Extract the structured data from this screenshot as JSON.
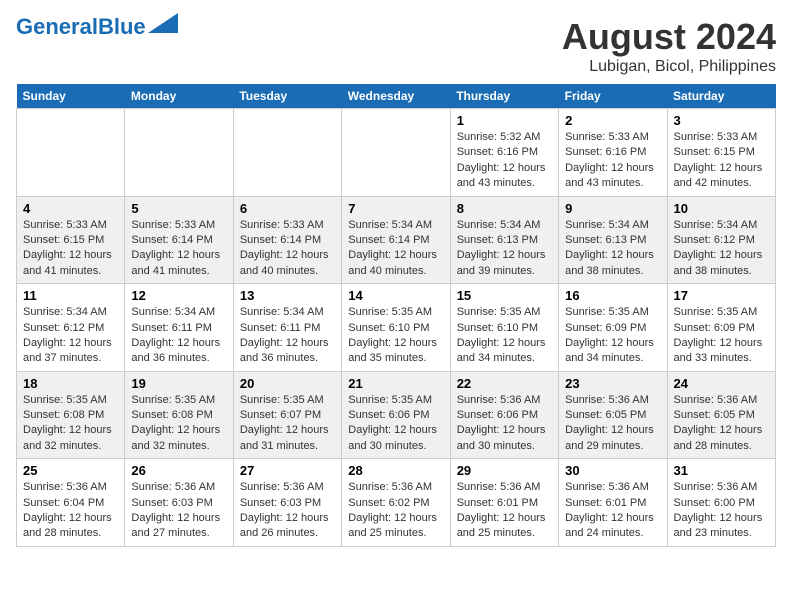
{
  "header": {
    "logo_general": "General",
    "logo_blue": "Blue",
    "title": "August 2024",
    "subtitle": "Lubigan, Bicol, Philippines"
  },
  "days_of_week": [
    "Sunday",
    "Monday",
    "Tuesday",
    "Wednesday",
    "Thursday",
    "Friday",
    "Saturday"
  ],
  "weeks": [
    [
      {
        "day": "",
        "text": ""
      },
      {
        "day": "",
        "text": ""
      },
      {
        "day": "",
        "text": ""
      },
      {
        "day": "",
        "text": ""
      },
      {
        "day": "1",
        "text": "Sunrise: 5:32 AM\nSunset: 6:16 PM\nDaylight: 12 hours and 43 minutes."
      },
      {
        "day": "2",
        "text": "Sunrise: 5:33 AM\nSunset: 6:16 PM\nDaylight: 12 hours and 43 minutes."
      },
      {
        "day": "3",
        "text": "Sunrise: 5:33 AM\nSunset: 6:15 PM\nDaylight: 12 hours and 42 minutes."
      }
    ],
    [
      {
        "day": "4",
        "text": "Sunrise: 5:33 AM\nSunset: 6:15 PM\nDaylight: 12 hours and 41 minutes."
      },
      {
        "day": "5",
        "text": "Sunrise: 5:33 AM\nSunset: 6:14 PM\nDaylight: 12 hours and 41 minutes."
      },
      {
        "day": "6",
        "text": "Sunrise: 5:33 AM\nSunset: 6:14 PM\nDaylight: 12 hours and 40 minutes."
      },
      {
        "day": "7",
        "text": "Sunrise: 5:34 AM\nSunset: 6:14 PM\nDaylight: 12 hours and 40 minutes."
      },
      {
        "day": "8",
        "text": "Sunrise: 5:34 AM\nSunset: 6:13 PM\nDaylight: 12 hours and 39 minutes."
      },
      {
        "day": "9",
        "text": "Sunrise: 5:34 AM\nSunset: 6:13 PM\nDaylight: 12 hours and 38 minutes."
      },
      {
        "day": "10",
        "text": "Sunrise: 5:34 AM\nSunset: 6:12 PM\nDaylight: 12 hours and 38 minutes."
      }
    ],
    [
      {
        "day": "11",
        "text": "Sunrise: 5:34 AM\nSunset: 6:12 PM\nDaylight: 12 hours and 37 minutes."
      },
      {
        "day": "12",
        "text": "Sunrise: 5:34 AM\nSunset: 6:11 PM\nDaylight: 12 hours and 36 minutes."
      },
      {
        "day": "13",
        "text": "Sunrise: 5:34 AM\nSunset: 6:11 PM\nDaylight: 12 hours and 36 minutes."
      },
      {
        "day": "14",
        "text": "Sunrise: 5:35 AM\nSunset: 6:10 PM\nDaylight: 12 hours and 35 minutes."
      },
      {
        "day": "15",
        "text": "Sunrise: 5:35 AM\nSunset: 6:10 PM\nDaylight: 12 hours and 34 minutes."
      },
      {
        "day": "16",
        "text": "Sunrise: 5:35 AM\nSunset: 6:09 PM\nDaylight: 12 hours and 34 minutes."
      },
      {
        "day": "17",
        "text": "Sunrise: 5:35 AM\nSunset: 6:09 PM\nDaylight: 12 hours and 33 minutes."
      }
    ],
    [
      {
        "day": "18",
        "text": "Sunrise: 5:35 AM\nSunset: 6:08 PM\nDaylight: 12 hours and 32 minutes."
      },
      {
        "day": "19",
        "text": "Sunrise: 5:35 AM\nSunset: 6:08 PM\nDaylight: 12 hours and 32 minutes."
      },
      {
        "day": "20",
        "text": "Sunrise: 5:35 AM\nSunset: 6:07 PM\nDaylight: 12 hours and 31 minutes."
      },
      {
        "day": "21",
        "text": "Sunrise: 5:35 AM\nSunset: 6:06 PM\nDaylight: 12 hours and 30 minutes."
      },
      {
        "day": "22",
        "text": "Sunrise: 5:36 AM\nSunset: 6:06 PM\nDaylight: 12 hours and 30 minutes."
      },
      {
        "day": "23",
        "text": "Sunrise: 5:36 AM\nSunset: 6:05 PM\nDaylight: 12 hours and 29 minutes."
      },
      {
        "day": "24",
        "text": "Sunrise: 5:36 AM\nSunset: 6:05 PM\nDaylight: 12 hours and 28 minutes."
      }
    ],
    [
      {
        "day": "25",
        "text": "Sunrise: 5:36 AM\nSunset: 6:04 PM\nDaylight: 12 hours and 28 minutes."
      },
      {
        "day": "26",
        "text": "Sunrise: 5:36 AM\nSunset: 6:03 PM\nDaylight: 12 hours and 27 minutes."
      },
      {
        "day": "27",
        "text": "Sunrise: 5:36 AM\nSunset: 6:03 PM\nDaylight: 12 hours and 26 minutes."
      },
      {
        "day": "28",
        "text": "Sunrise: 5:36 AM\nSunset: 6:02 PM\nDaylight: 12 hours and 25 minutes."
      },
      {
        "day": "29",
        "text": "Sunrise: 5:36 AM\nSunset: 6:01 PM\nDaylight: 12 hours and 25 minutes."
      },
      {
        "day": "30",
        "text": "Sunrise: 5:36 AM\nSunset: 6:01 PM\nDaylight: 12 hours and 24 minutes."
      },
      {
        "day": "31",
        "text": "Sunrise: 5:36 AM\nSunset: 6:00 PM\nDaylight: 12 hours and 23 minutes."
      }
    ]
  ]
}
